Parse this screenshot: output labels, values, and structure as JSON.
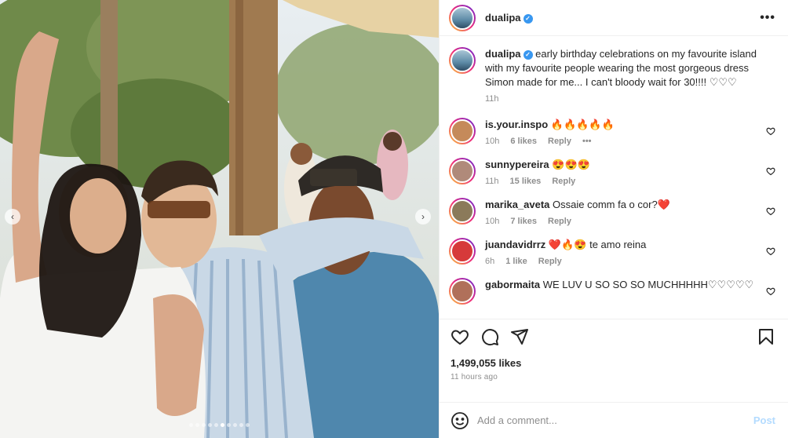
{
  "post": {
    "username": "dualipa",
    "more_label": "•••",
    "photo_dot_count": 10,
    "photo_active_dot": 5
  },
  "caption": {
    "username": "dualipa",
    "text": "early birthday celebrations on my favourite island with my favourite people wearing the most gorgeous dress Simon made for me... I can't bloody wait for 30!!!! ♡♡♡",
    "time": "11h"
  },
  "comments": [
    {
      "username": "is.your.inspo",
      "text": "🔥🔥🔥🔥🔥",
      "time": "10h",
      "likes": "6 likes",
      "reply": "Reply",
      "more": "•••",
      "avatar_color": "#c58a5a"
    },
    {
      "username": "sunnypereira",
      "text": "😍😍😍",
      "time": "11h",
      "likes": "15 likes",
      "reply": "Reply",
      "avatar_color": "#b08a7a"
    },
    {
      "username": "marika_aveta",
      "text": "Ossaie comm fa o cor?❤️",
      "time": "10h",
      "likes": "7 likes",
      "reply": "Reply",
      "avatar_color": "#8b7a5a"
    },
    {
      "username": "juandavidrrz",
      "text": "❤️🔥😍 te amo reina",
      "time": "6h",
      "likes": "1 like",
      "reply": "Reply",
      "avatar_color": "#d63a3a"
    },
    {
      "username": "gabormaita",
      "text": "WE LUV U SO SO SO MUCHHHHH♡♡♡♡♡",
      "time": "",
      "likes": "",
      "reply": "",
      "avatar_color": "#b0705a"
    }
  ],
  "footer": {
    "likes": "1,499,055 likes",
    "time": "11 hours ago",
    "comment_placeholder": "Add a comment...",
    "post_label": "Post"
  },
  "nav": {
    "prev": "‹",
    "next": "›"
  },
  "icons": [
    "heart-icon",
    "comment-icon",
    "share-icon",
    "bookmark-icon",
    "emoji-icon"
  ]
}
